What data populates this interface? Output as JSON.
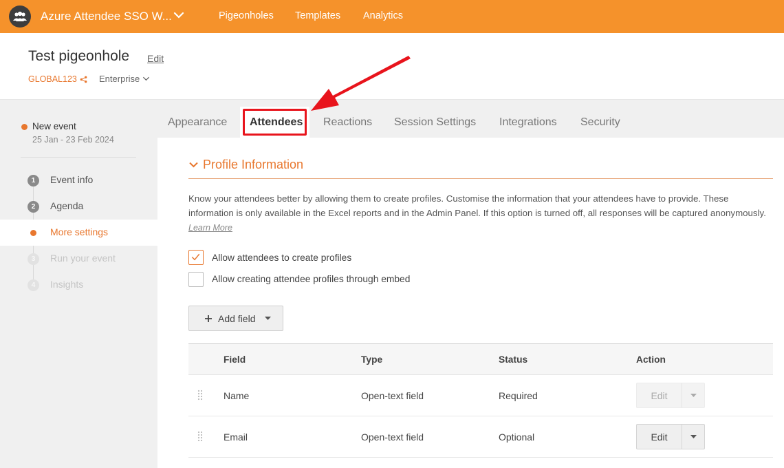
{
  "app": {
    "title": "Azure Attendee SSO W...",
    "nav": [
      "Pigeonholes",
      "Templates",
      "Analytics"
    ]
  },
  "header": {
    "title": "Test pigeonhole",
    "edit_label": "Edit",
    "code": "GLOBAL123",
    "plan": "Enterprise"
  },
  "sidebar": {
    "event_name": "New event",
    "event_dates": "25 Jan - 23 Feb 2024",
    "steps": [
      {
        "num": "1",
        "label": "Event info",
        "state": "done"
      },
      {
        "num": "2",
        "label": "Agenda",
        "state": "done"
      },
      {
        "num": "",
        "label": "More settings",
        "state": "active"
      },
      {
        "num": "3",
        "label": "Run your event",
        "state": "muted"
      },
      {
        "num": "4",
        "label": "Insights",
        "state": "muted"
      }
    ]
  },
  "tabs": [
    "Appearance",
    "Attendees",
    "Reactions",
    "Session Settings",
    "Integrations",
    "Security"
  ],
  "active_tab": "Attendees",
  "section": {
    "title": "Profile Information",
    "description": "Know your attendees better by allowing them to create profiles. Customise the information that your attendees have to provide. These information is only available in the Excel reports and in the Admin Panel. If this option is turned off, all responses will be captured anonymously.",
    "learn_more": "Learn More",
    "options": [
      {
        "label": "Allow attendees to create profiles",
        "checked": true
      },
      {
        "label": "Allow creating attendee profiles through embed",
        "checked": false
      }
    ],
    "add_field_label": "Add field"
  },
  "table": {
    "headers": [
      "Field",
      "Type",
      "Status",
      "Action"
    ],
    "rows": [
      {
        "field": "Name",
        "type": "Open-text field",
        "status": "Required",
        "action": "Edit",
        "disabled": true
      },
      {
        "field": "Email",
        "type": "Open-text field",
        "status": "Optional",
        "action": "Edit",
        "disabled": false
      }
    ]
  },
  "colors": {
    "brand": "#f5922b",
    "accent": "#e8772e",
    "highlight": "#e8141c"
  }
}
